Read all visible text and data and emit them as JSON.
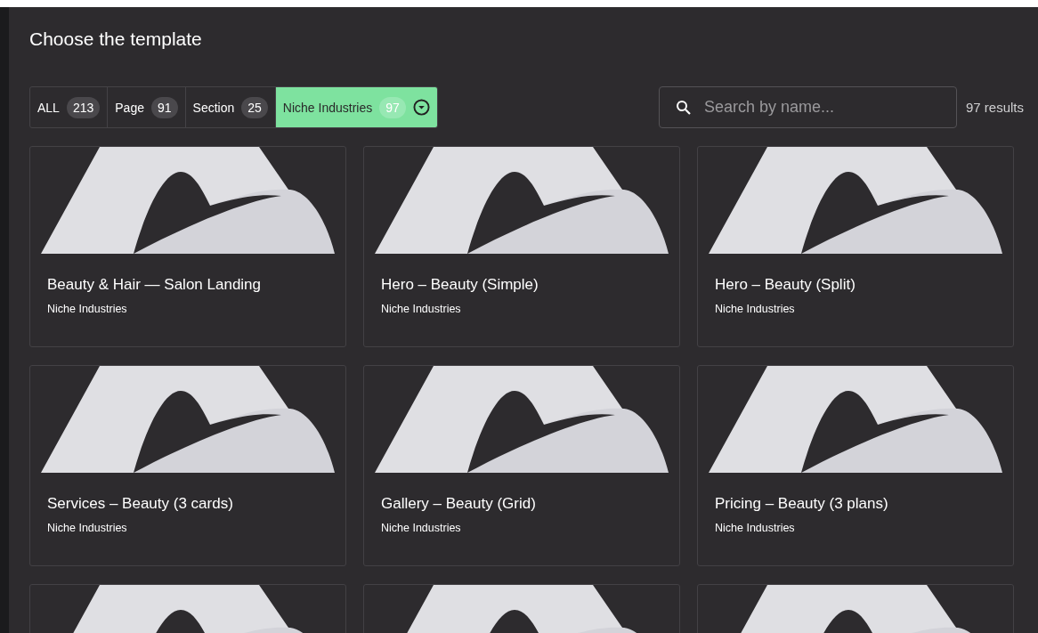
{
  "dialog": {
    "title": "Choose the template"
  },
  "tabs": [
    {
      "label": "ALL",
      "count": "213",
      "selected": false
    },
    {
      "label": "Page",
      "count": "91",
      "selected": false
    },
    {
      "label": "Section",
      "count": "25",
      "selected": false
    },
    {
      "label": "Niche Industries",
      "count": "97",
      "selected": true
    }
  ],
  "search": {
    "placeholder": "Search by name..."
  },
  "results": "97 results",
  "cards": [
    {
      "kind": "full",
      "title": "Beauty & Hair — Salon Landing",
      "category": "Niche Industries"
    },
    {
      "kind": "full",
      "title": "Hero – Beauty (Simple)",
      "category": "Niche Industries"
    },
    {
      "kind": "full",
      "title": "Hero – Beauty (Split)",
      "category": "Niche Industries"
    },
    {
      "kind": "full",
      "title": "Services – Beauty (3 cards)",
      "category": "Niche Industries"
    },
    {
      "kind": "full",
      "title": "Gallery – Beauty (Grid)",
      "category": "Niche Industries"
    },
    {
      "kind": "full",
      "title": "Pricing – Beauty (3 plans)",
      "category": "Niche Industries"
    },
    {
      "kind": "cut"
    },
    {
      "kind": "cut"
    },
    {
      "kind": "cut"
    }
  ]
}
